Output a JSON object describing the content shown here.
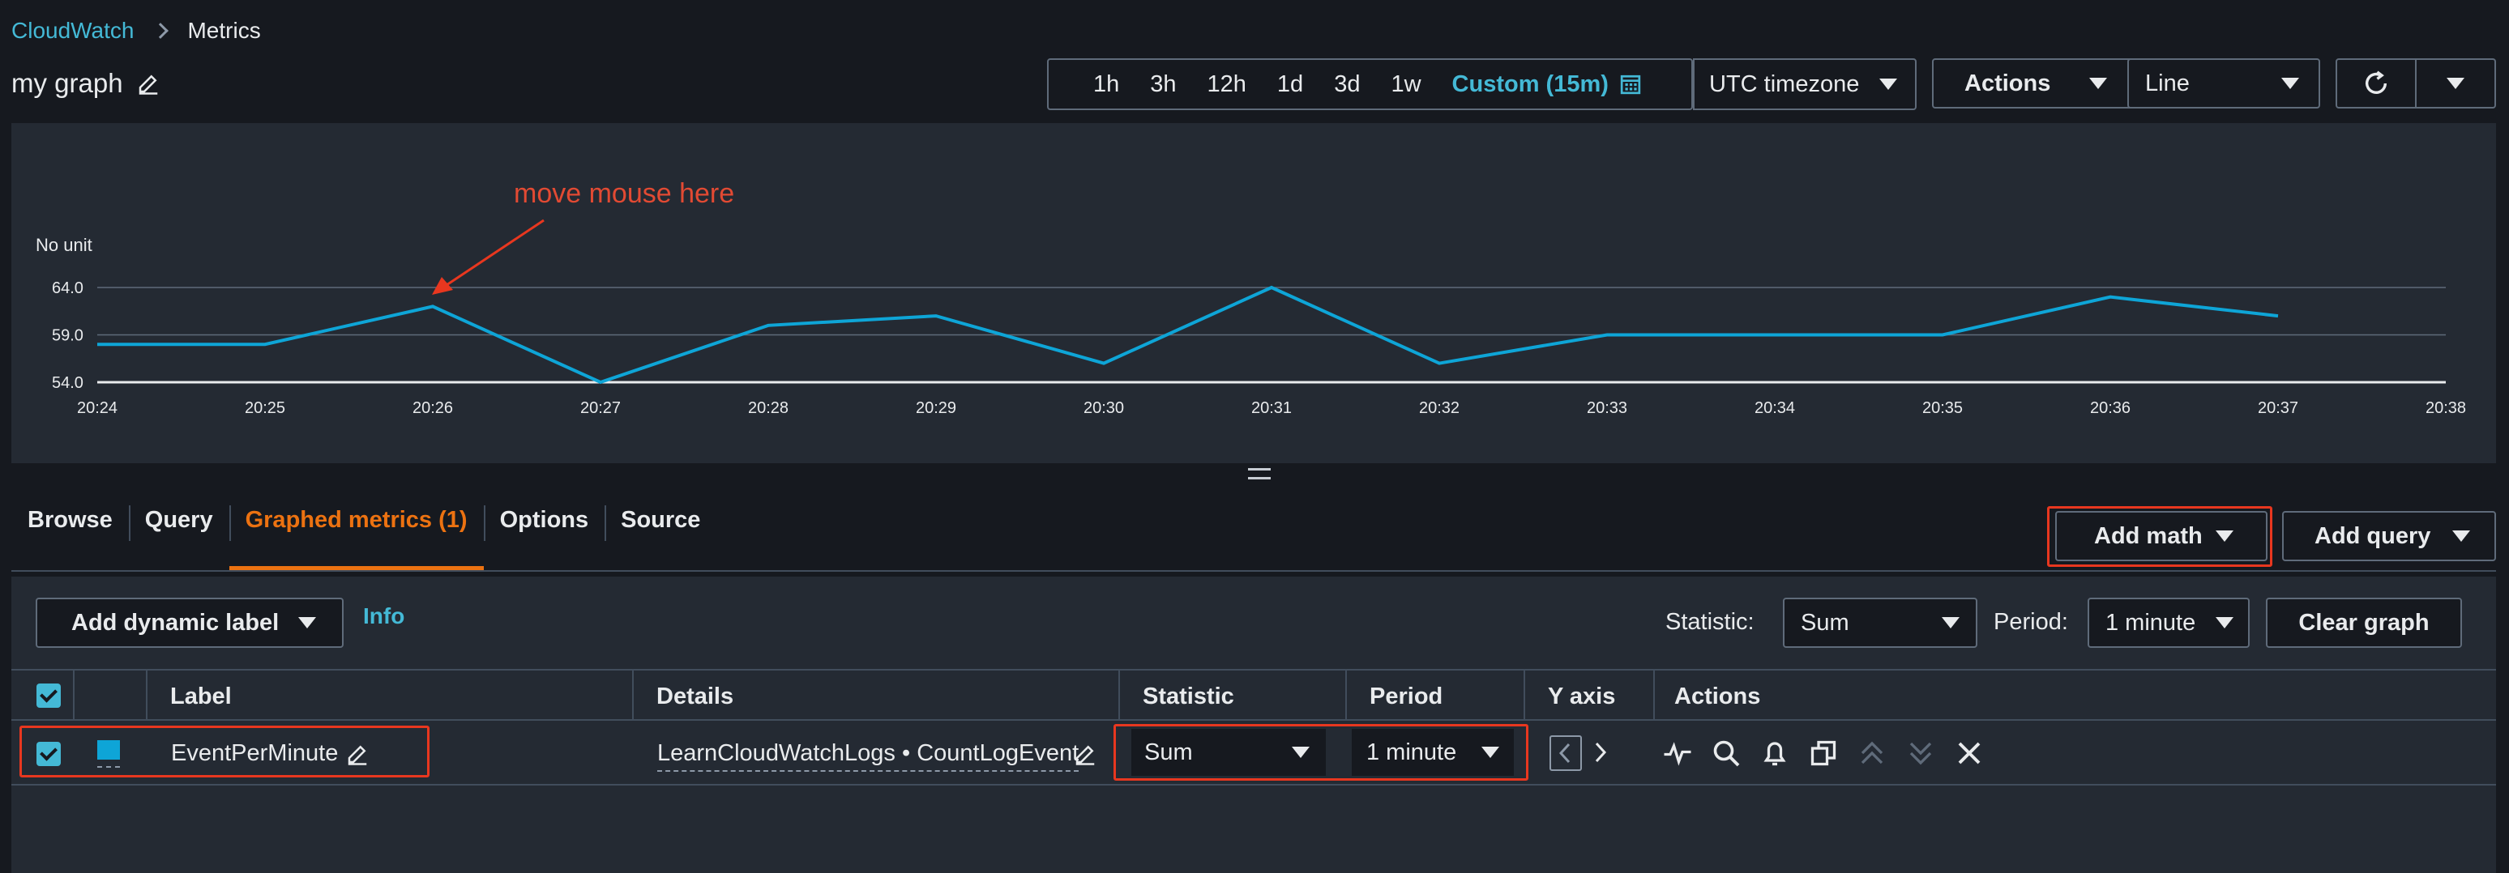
{
  "breadcrumb": {
    "root": "CloudWatch",
    "current": "Metrics"
  },
  "graph": {
    "title": "my graph"
  },
  "toolbar": {
    "time_ranges": [
      "1h",
      "3h",
      "12h",
      "1d",
      "3d",
      "1w"
    ],
    "custom_label": "Custom (15m)",
    "timezone": "UTC timezone",
    "actions_label": "Actions",
    "chart_type": "Line"
  },
  "annotation": "move mouse here",
  "chart_data": {
    "type": "line",
    "ylabel": "No unit",
    "y_ticks": [
      "54.0",
      "59.0",
      "64.0"
    ],
    "ylim": [
      54,
      64
    ],
    "x": [
      "20:24",
      "20:25",
      "20:26",
      "20:27",
      "20:28",
      "20:29",
      "20:30",
      "20:31",
      "20:32",
      "20:33",
      "20:34",
      "20:35",
      "20:36",
      "20:37",
      "20:38"
    ],
    "series": [
      {
        "values": [
          58,
          58,
          62,
          54,
          60,
          61,
          56,
          64,
          56,
          59,
          59,
          59,
          63,
          61,
          null
        ],
        "color": "#0ea5d7"
      }
    ],
    "grid": "horizontal"
  },
  "tabs": [
    "Browse",
    "Query",
    "Graphed metrics (1)",
    "Options",
    "Source"
  ],
  "active_tab": "Graphed metrics (1)",
  "buttons": {
    "add_math": "Add math",
    "add_query": "Add query",
    "add_dynamic_label": "Add dynamic label",
    "clear_graph": "Clear graph"
  },
  "info_link": "Info",
  "global": {
    "statistic_label": "Statistic:",
    "statistic": "Sum",
    "period_label": "Period:",
    "period": "1 minute"
  },
  "table": {
    "headers": {
      "label": "Label",
      "details": "Details",
      "statistic": "Statistic",
      "period": "Period",
      "y_axis": "Y axis",
      "actions": "Actions"
    },
    "row": {
      "label": "EventPerMinute",
      "details": "LearnCloudWatchLogs • CountLogEvent",
      "statistic": "Sum",
      "period": "1 minute",
      "color": "#0ea5d7"
    }
  }
}
